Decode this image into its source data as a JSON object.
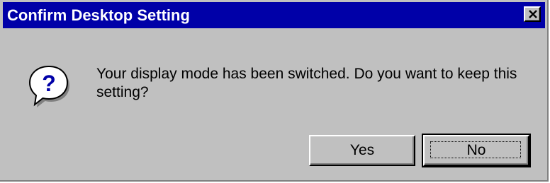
{
  "window": {
    "title": "Confirm Desktop Setting"
  },
  "titlebar": {
    "background": "#0000a8",
    "text_color": "#ffffff",
    "close_icon": "close-x-icon"
  },
  "dialog": {
    "background": "#c0c0c0",
    "icon": "question-balloon-icon",
    "message": "Your display mode has been switched. Do you want to keep this setting?"
  },
  "buttons": {
    "yes_label": "Yes",
    "no_label": "No",
    "default_focused": "No"
  }
}
